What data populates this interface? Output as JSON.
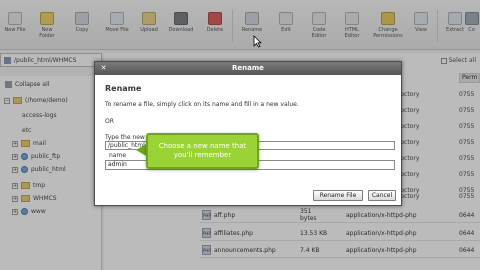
{
  "toolbar": {
    "buttons": [
      {
        "label_l1": "New File",
        "label_l2": "",
        "color": "#e8e8e8"
      },
      {
        "label_l1": "New",
        "label_l2": "Folder",
        "color": "#f2cf5a"
      },
      {
        "label_l1": "Copy",
        "label_l2": "",
        "color": "#cfd6df"
      },
      {
        "label_l1": "Move File",
        "label_l2": "",
        "color": "#dde6ef"
      },
      {
        "label_l1": "Upload",
        "label_l2": "",
        "color": "#e7d27a"
      },
      {
        "label_l1": "Download",
        "label_l2": "",
        "color": "#6d7378"
      },
      {
        "label_l1": "Delete",
        "label_l2": "",
        "color": "#d94c4c"
      },
      {
        "label_l1": "Rename",
        "label_l2": "",
        "color": "#cfd6df"
      },
      {
        "label_l1": "Edit",
        "label_l2": "",
        "color": "#e6e6e6"
      },
      {
        "label_l1": "Code",
        "label_l2": "Editor",
        "color": "#e6e6e6"
      },
      {
        "label_l1": "HTML",
        "label_l2": "Editor",
        "color": "#e6e6e6"
      },
      {
        "label_l1": "Change",
        "label_l2": "Permissions",
        "color": "#e8c64f"
      },
      {
        "label_l1": "View",
        "label_l2": "",
        "color": "#dfe6ee"
      },
      {
        "label_l1": "Extract",
        "label_l2": "",
        "color": "#dde5ee"
      },
      {
        "label_l1": "Co",
        "label_l2": "",
        "color": "#9aa8b5"
      }
    ]
  },
  "pathbar": {
    "value": "/public_html/WHMCS"
  },
  "sidebar": {
    "collapse_label": "Collapse all",
    "tree": [
      {
        "label": "(/home/demo)"
      },
      {
        "label": "access-logs"
      },
      {
        "label": "etc"
      },
      {
        "label": "mail"
      },
      {
        "label": "public_ftp"
      },
      {
        "label": "public_html"
      },
      {
        "label": "tmp"
      },
      {
        "label": "WHMCS"
      },
      {
        "label": "www"
      }
    ]
  },
  "content": {
    "select_all": "Select all",
    "perm_header": "Perm",
    "dir_cells": [
      "rectory",
      "rectory",
      "rectory",
      "rectory",
      "rectory",
      "rectory",
      "rectory",
      "rectory"
    ],
    "perm_cells": [
      "0755",
      "0755",
      "0755",
      "0755",
      "0755",
      "0755",
      "0755",
      "0755"
    ],
    "rows": [
      {
        "name": "aff.php",
        "size_l1": "351",
        "size_l2": "bytes",
        "type": "application/x-httpd-php",
        "perm": "0644"
      },
      {
        "name": "affiliates.php",
        "size_l1": "13.53 KB",
        "size_l2": "",
        "type": "application/x-httpd-php",
        "perm": "0644"
      },
      {
        "name": "announcements.php",
        "size_l1": "7.4 KB",
        "size_l2": "",
        "type": "application/x-httpd-php",
        "perm": "0644"
      }
    ]
  },
  "dialog": {
    "title": "Rename",
    "heading": "Rename",
    "instruction": "To rename a file, simply click on its name and fill in a new value.",
    "or": "OR",
    "type_new": "Type the new",
    "path_value": "/public_html/W",
    "name_label": "name",
    "name_value": "admin",
    "rename_button": "Rename File",
    "cancel_button": "Cancel"
  },
  "callout": {
    "line1": "Choose a new name that",
    "line2": "you'll remember"
  },
  "colors": {
    "callout": "#9bd235",
    "title_bar": "#5f5f5f"
  }
}
